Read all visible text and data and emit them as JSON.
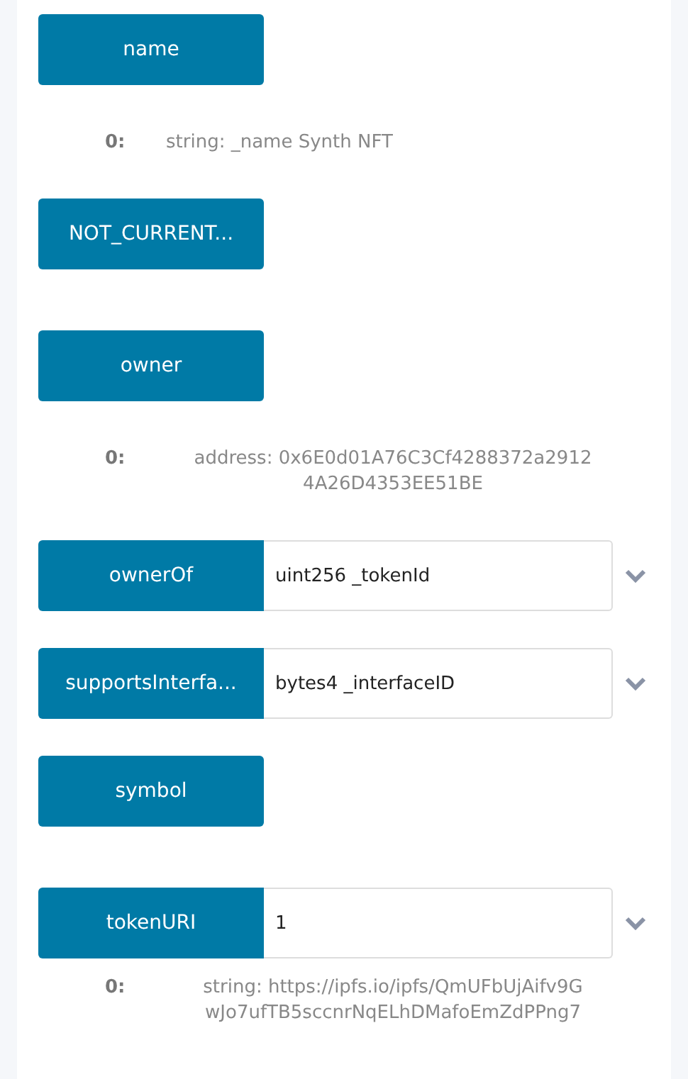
{
  "functions": [
    {
      "label": "name",
      "results": [
        {
          "index": "0:",
          "value": "string: _name Synth NFT"
        }
      ]
    },
    {
      "label": "NOT_CURRENT..."
    },
    {
      "label": "owner",
      "results": [
        {
          "index": "0:",
          "value": "address: 0x6E0d01A76C3Cf4288372a2912 4A26D4353EE51BE"
        }
      ]
    },
    {
      "label": "ownerOf",
      "input": {
        "placeholder": "uint256 _tokenId"
      }
    },
    {
      "label": "supportsInterfa...",
      "input": {
        "placeholder": "bytes4 _interfaceID"
      }
    },
    {
      "label": "symbol"
    },
    {
      "label": "tokenURI",
      "input": {
        "value": "1"
      },
      "results": [
        {
          "index": "0:",
          "value": "string: https://ipfs.io/ipfs/QmUFbUjAifv9G wJo7ufTB5sccnrNqELhDMafoEmZdPPng7"
        }
      ]
    }
  ]
}
